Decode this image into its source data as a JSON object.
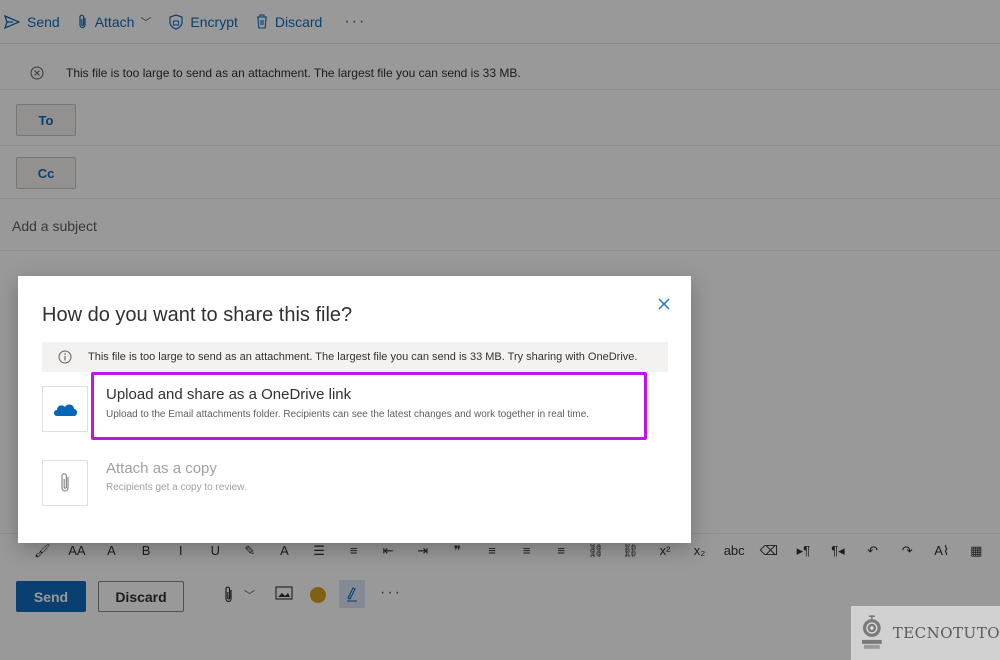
{
  "toolbar": {
    "send_label": "Send",
    "attach_label": "Attach",
    "encrypt_label": "Encrypt",
    "discard_label": "Discard",
    "more_label": "···"
  },
  "error_bar": {
    "message": "This file is too large to send as an attachment. The largest file you can send is 33 MB."
  },
  "fields": {
    "to_label": "To",
    "cc_label": "Cc",
    "subject_placeholder": "Add a subject"
  },
  "format_toolbar": {
    "items": [
      {
        "icon": "format-painter-icon",
        "glyph": "🖌"
      },
      {
        "icon": "font-size-icon",
        "glyph": "AA"
      },
      {
        "icon": "superscript-size-icon",
        "glyph": "A"
      },
      {
        "icon": "bold-icon",
        "glyph": "B"
      },
      {
        "icon": "italic-icon",
        "glyph": "I"
      },
      {
        "icon": "underline-icon",
        "glyph": "U"
      },
      {
        "icon": "highlight-icon",
        "glyph": "✎"
      },
      {
        "icon": "font-color-icon",
        "glyph": "A"
      },
      {
        "icon": "bullets-icon",
        "glyph": "☰"
      },
      {
        "icon": "numbering-icon",
        "glyph": "≡"
      },
      {
        "icon": "decrease-indent-icon",
        "glyph": "⇤"
      },
      {
        "icon": "increase-indent-icon",
        "glyph": "⇥"
      },
      {
        "icon": "quote-icon",
        "glyph": "❞"
      },
      {
        "icon": "align-left-icon",
        "glyph": "≡"
      },
      {
        "icon": "align-center-icon",
        "glyph": "≡"
      },
      {
        "icon": "align-right-icon",
        "glyph": "≡"
      },
      {
        "icon": "link-icon",
        "glyph": "⛓"
      },
      {
        "icon": "unlink-icon",
        "glyph": "⛓"
      },
      {
        "icon": "superscript-icon",
        "glyph": "x²"
      },
      {
        "icon": "subscript-icon",
        "glyph": "x₂"
      },
      {
        "icon": "strikethrough-icon",
        "glyph": "abc"
      },
      {
        "icon": "clear-formatting-icon",
        "glyph": "⌫"
      },
      {
        "icon": "ltr-icon",
        "glyph": "▸¶"
      },
      {
        "icon": "rtl-icon",
        "glyph": "¶◂"
      },
      {
        "icon": "undo-icon",
        "glyph": "↶"
      },
      {
        "icon": "redo-icon",
        "glyph": "↷"
      },
      {
        "icon": "styles-icon",
        "glyph": "A⌇"
      },
      {
        "icon": "table-icon",
        "glyph": "▦"
      }
    ]
  },
  "bottom_bar": {
    "send_label": "Send",
    "discard_label": "Discard",
    "more_label": "···",
    "emoji_color": "#d6a01e"
  },
  "dialog": {
    "title": "How do you want to share this file?",
    "info_message": "This file is too large to send as an attachment. The largest file you can send is 33 MB. Try sharing with OneDrive.",
    "options": [
      {
        "title": "Upload and share as a OneDrive link",
        "description": "Upload to the Email attachments folder. Recipients can see the latest changes and work together in real time.",
        "icon": "onedrive-cloud-icon"
      },
      {
        "title": "Attach as a copy",
        "description": "Recipients get a copy to review.",
        "icon": "paperclip-icon"
      }
    ],
    "highlight_color": "#c214e6"
  },
  "watermark": {
    "text": "TECNOTUTO"
  },
  "colors": {
    "accent": "#0f6cbd",
    "onedrive": "#0364b8"
  }
}
